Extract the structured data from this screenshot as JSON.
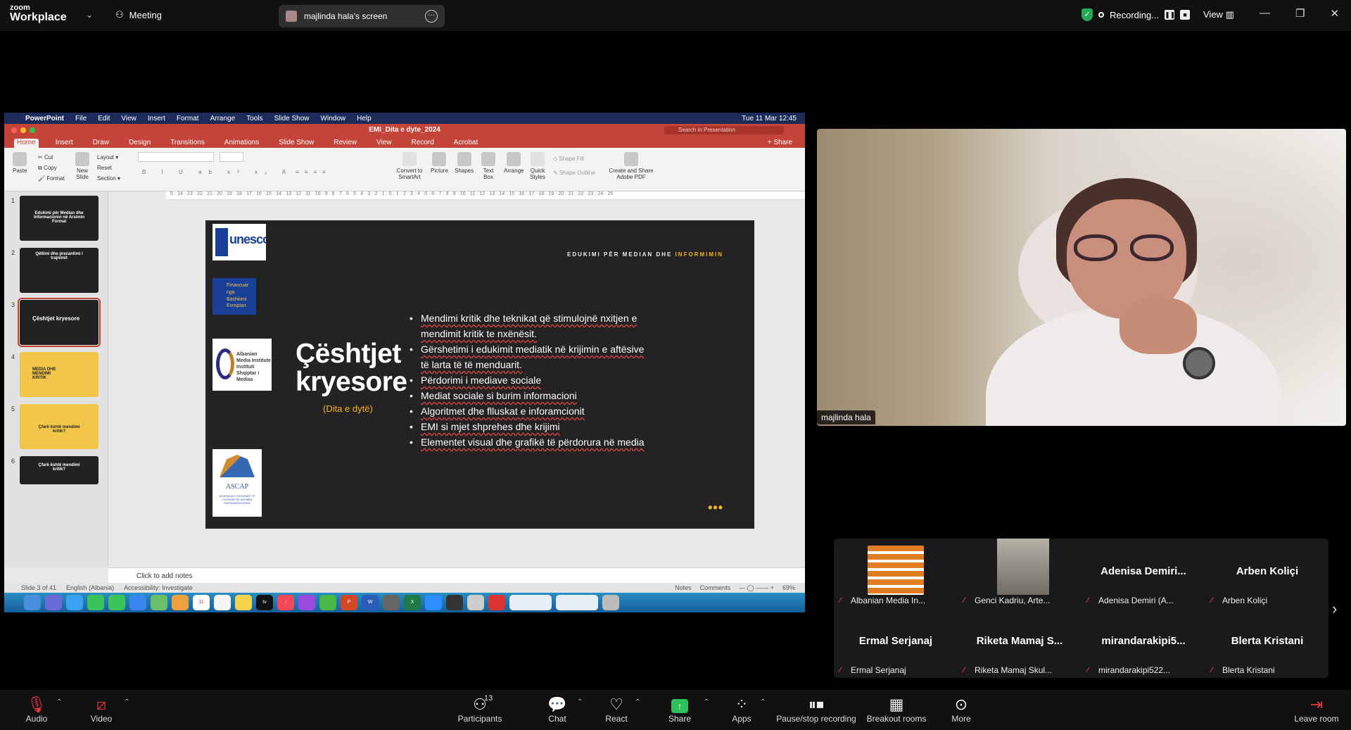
{
  "zoom": {
    "logo_line1": "zoom",
    "logo_line2": "Workplace",
    "meeting_label": "Meeting",
    "screen_share_label": "majlinda hala's screen",
    "recording_label": "Recording...",
    "view_label": "View"
  },
  "mac": {
    "app": "PowerPoint",
    "menus": [
      "File",
      "Edit",
      "View",
      "Insert",
      "Format",
      "Arrange",
      "Tools",
      "Slide Show",
      "Window",
      "Help"
    ],
    "clock": "Tue 11 Mar  12:45"
  },
  "powerpoint": {
    "doc_title": "EMI_Dita e dyte_2024",
    "search_placeholder": "Search in Presentation",
    "tabs": [
      "Home",
      "Insert",
      "Draw",
      "Design",
      "Transitions",
      "Animations",
      "Slide Show",
      "Review",
      "View",
      "Record",
      "Acrobat"
    ],
    "share_label": "Share",
    "ribbon": {
      "paste": "Paste",
      "cut": "Cut",
      "copy": "Copy",
      "format": "Format",
      "new_slide": "New Slide",
      "layout": "Layout",
      "reset": "Reset",
      "section": "Section",
      "convert": "Convert to SmartArt",
      "picture": "Picture",
      "shapes": "Shapes",
      "text_box": "Text Box",
      "arrange": "Arrange",
      "quick_styles": "Quick Styles",
      "shape_fill": "Shape Fill",
      "shape_outline": "Shape Outline",
      "create_pdf": "Create and Share Adobe PDF"
    },
    "ruler": "5 · 24 · 23 · 22 · 21 · 20 · 19 · 18 · 17 · 16 · 15 · 14 · 13 · 12 · 11 · 10 · 9 · 8 · 7 · 6 · 5 · 4 · 3 · 2 · 1 · 0 · 1 · 2 · 3 · 4 · 5 · 6 · 7 · 8 · 9 · 10 · 11 · 12 · 13 · 14 · 15 · 16 · 17 · 18 · 19 · 20 · 21 · 22 · 23 · 24 · 25",
    "thumbnails": [
      {
        "num": "1",
        "text": "Edukimi për Median dhe Informacionin në Arsimin Formal"
      },
      {
        "num": "2",
        "text": "Qëllimi dhe prezantimi i trajnimit"
      },
      {
        "num": "3",
        "text": "Çështjet kryesore"
      },
      {
        "num": "4",
        "text": "MEDIA DHE MENDIMI KRITIK"
      },
      {
        "num": "5",
        "text": "Çfarë është mendimi kritik?"
      },
      {
        "num": "6",
        "text": "Çfarë është mendimi kritik?"
      }
    ],
    "notes_placeholder": "Click to add notes",
    "status": {
      "slide_of": "Slide 3 of 41",
      "language": "English (Albania)",
      "accessibility": "Accessibility: Investigate",
      "notes": "Notes",
      "comments": "Comments",
      "zoom": "69%"
    }
  },
  "slide": {
    "header_prefix": "EDUKIMI PËR MEDIAN DHE",
    "header_accent": "INFORMIMIN",
    "title_line1": "Çështjet",
    "title_line2": "kryesore",
    "subtitle": "(Dita e dytë)",
    "unesco": "unesco",
    "eu_text": "Financuar nga Bashkimi Evropian",
    "amii_text": "Albanian Media Institute Instituti Shqiptar i Medias",
    "ascap_name": "ASCAP",
    "ascap_sub": "AGJENCIA E SIGURIMIT TË CILËSISË NË ARSIMIN PARAUNIVERSITAR",
    "bullets": [
      "Mendimi kritik dhe teknikat që stimulojnë nxitjen e mendimit kritik te nxënësit.",
      "Gërshetimi i edukimit mediatik në krijimin e aftësive të larta të të menduarit.",
      "Përdorimi i mediave sociale",
      "Mediat sociale si burim informacioni",
      "Algoritmet dhe flluskat e inforamcionit",
      "EMI si mjet shprehes dhe krijimi",
      "Elementet visual dhe grafikë të përdorura në media"
    ],
    "dots": "•••"
  },
  "camera": {
    "name": "majlinda hala"
  },
  "gallery": [
    {
      "display": "",
      "label": "Albanian Media In..."
    },
    {
      "display": "",
      "label": "Genci Kadriu, Arte..."
    },
    {
      "display": "Adenisa Demiri...",
      "label": "Adenisa Demiri (A..."
    },
    {
      "display": "Arben Koliçi",
      "label": "Arben Koliçi"
    },
    {
      "display": "Ermal Serjanaj",
      "label": "Ermal Serjanaj"
    },
    {
      "display": "Riketa Mamaj S...",
      "label": "Riketa Mamaj Skul..."
    },
    {
      "display": "mirandarakipi5...",
      "label": "mirandarakipi522..."
    },
    {
      "display": "Blerta Kristani",
      "label": "Blerta Kristani"
    }
  ],
  "toolbar": {
    "audio": "Audio",
    "video": "Video",
    "participants": "Participants",
    "participants_count": "13",
    "chat": "Chat",
    "react": "React",
    "share": "Share",
    "apps": "Apps",
    "pause_recording": "Pause/stop recording",
    "breakout": "Breakout rooms",
    "more": "More",
    "leave": "Leave room"
  },
  "colors": {
    "pp_red": "#c4443a",
    "slide_bg": "#252223",
    "accent_yellow": "#f2b51f",
    "share_green": "#2ec05a",
    "muted_red": "#e0383e"
  }
}
